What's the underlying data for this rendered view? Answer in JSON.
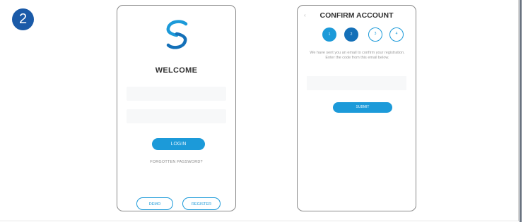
{
  "step_number": "2",
  "login_screen": {
    "welcome": "WELCOME",
    "login_label": "LOGIN",
    "forgot_label": "FORGOTTEN PASSWORD?",
    "demo_label": "DEMO",
    "register_label": "REGISTER"
  },
  "confirm_screen": {
    "back_icon": "back-arrow-icon",
    "title": "CONFIRM ACCOUNT",
    "steps": [
      "1",
      "2",
      "3",
      "4"
    ],
    "message": "We have sent you an email to confirm your registration. Enter the code from this email below.",
    "submit_label": "SUBMIT"
  },
  "colors": {
    "accent": "#1c9ad9",
    "accent_dark": "#1470b8",
    "badge": "#1a5aa8"
  }
}
